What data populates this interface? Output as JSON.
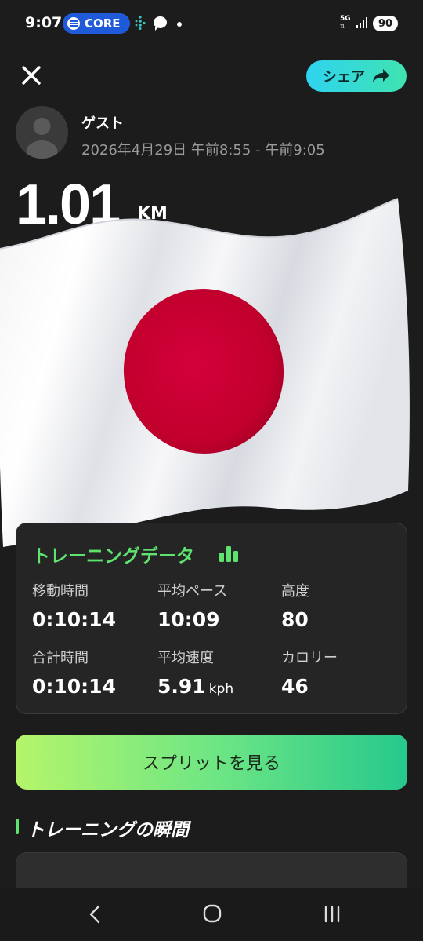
{
  "status_bar": {
    "time": "9:07",
    "core_label": "CORE",
    "network": "5G",
    "battery": "90"
  },
  "header": {
    "share_label": "シェア"
  },
  "profile": {
    "name": "ゲスト",
    "session_time": "2026年4月29日 午前8:55 - 午前9:05"
  },
  "summary": {
    "distance": "1.01",
    "distance_unit": "KM"
  },
  "training_data": {
    "title": "トレーニングデータ",
    "stats": [
      {
        "label": "移動時間",
        "value": "0:10:14",
        "unit": ""
      },
      {
        "label": "平均ペース",
        "value": "10:09",
        "unit": ""
      },
      {
        "label": "高度",
        "value": "80",
        "unit": ""
      },
      {
        "label": "合計時間",
        "value": "0:10:14",
        "unit": ""
      },
      {
        "label": "平均速度",
        "value": "5.91",
        "unit": "kph"
      },
      {
        "label": "カロリー",
        "value": "46",
        "unit": ""
      }
    ]
  },
  "splits_button_label": "スプリットを見る",
  "moments": {
    "title": "トレーニングの瞬間"
  },
  "colors": {
    "accent_green": "#5ee36e",
    "share_gradient_start": "#2fd3f0",
    "share_gradient_end": "#3fe3b0",
    "flag_red": "#c8002f"
  },
  "icons": [
    "close-icon",
    "share-arrow-icon",
    "avatar-person-icon",
    "bar-chart-icon",
    "nav-back-icon",
    "nav-home-icon",
    "nav-recent-icon"
  ]
}
